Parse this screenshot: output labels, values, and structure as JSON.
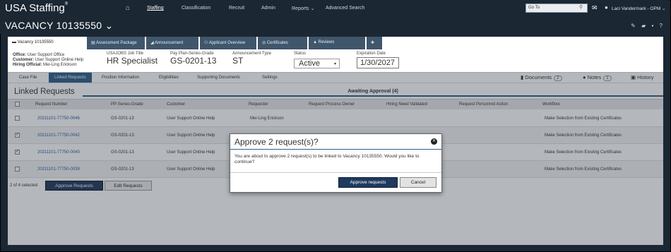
{
  "nav": {
    "brand": "USA Staffing",
    "brand_mark": "®",
    "links": [
      "Staffing",
      "Classification",
      "Recruit",
      "Admin",
      "Reports ⌄",
      "Advanced Search"
    ],
    "goto_placeholder": "Go To",
    "user": "Laci Vandermark - OPM ⌄"
  },
  "vacancy": {
    "title": "VACANCY 10135550 ⌄"
  },
  "tabs": [
    "Vacancy 10135550",
    "Assessment Package",
    "Announcement",
    "Applicant Overview",
    "Certificates",
    "Reviews"
  ],
  "info": {
    "office_label": "Office:",
    "office": "User Support Office",
    "customer_label": "Customer:",
    "customer": "User Support Online Help",
    "hiring_label": "Hiring Official:",
    "hiring": "Mei-Ling Erickson",
    "job_title_label": "USAJOBS Job Title",
    "job_title": "HR Specialist",
    "pps_label": "Pay Plan-Series-Grade",
    "pps": "GS-0201-13",
    "ann_type_label": "Announcement Type",
    "ann_type": "ST",
    "status_label": "Status",
    "status": "Active",
    "exp_label": "Expiration Date",
    "exp": "1/30/2027"
  },
  "steps": [
    "Case File",
    "Linked Requests",
    "Position Information",
    "Eligibilities",
    "Supporting Documents",
    "Settings"
  ],
  "step_right": {
    "documents": "Documents",
    "documents_count": "2",
    "notes": "Notes",
    "notes_count": "1",
    "history": "History"
  },
  "section": {
    "title": "Linked Requests",
    "awaiting": "Awaiting Approval (4)"
  },
  "table": {
    "headers": [
      "Request Number",
      "PP-Series-Grade",
      "Customer",
      "Requester",
      "Request Process Owner",
      "Hiring Need Validated",
      "Request Personnel Action",
      "Workflow"
    ],
    "rows": [
      {
        "checked": false,
        "number": "20211101-77750-0046",
        "pps": "GS-0201-13",
        "customer": "User Support Online Help",
        "requester": "Mei-Ling Erickson",
        "workflow": "Make Selection from Existing Certificates"
      },
      {
        "checked": true,
        "number": "20211101-77750-0042",
        "pps": "GS-0201-13",
        "customer": "User Support Online Help",
        "requester": "",
        "workflow": "Make Selection from Existing Certificates"
      },
      {
        "checked": true,
        "number": "20211101-77750-0040",
        "pps": "GS-0201-13",
        "customer": "User Support Online Help",
        "requester": "",
        "workflow": "Make Selection from Existing Certificates"
      },
      {
        "checked": false,
        "number": "20211101-77750-0039",
        "pps": "GS-0201-13",
        "customer": "User Support Online Help",
        "requester": "",
        "workflow": "Make Selection from Existing Certificates"
      }
    ]
  },
  "footer": {
    "selected": "2 of 4 selected",
    "approve": "Approve Requests",
    "edit": "Edit Requests"
  },
  "modal": {
    "title": "Approve 2 request(s)?",
    "body": "You are about to approve 2 request(s) to be linked to Vacancy 10135550. Would you like to continue?",
    "approve": "Approve requests",
    "cancel": "Cancel"
  },
  "colors": {
    "nav_bg": "#1b2733",
    "primary": "#1f3a5f",
    "link": "#2a5a9a"
  }
}
